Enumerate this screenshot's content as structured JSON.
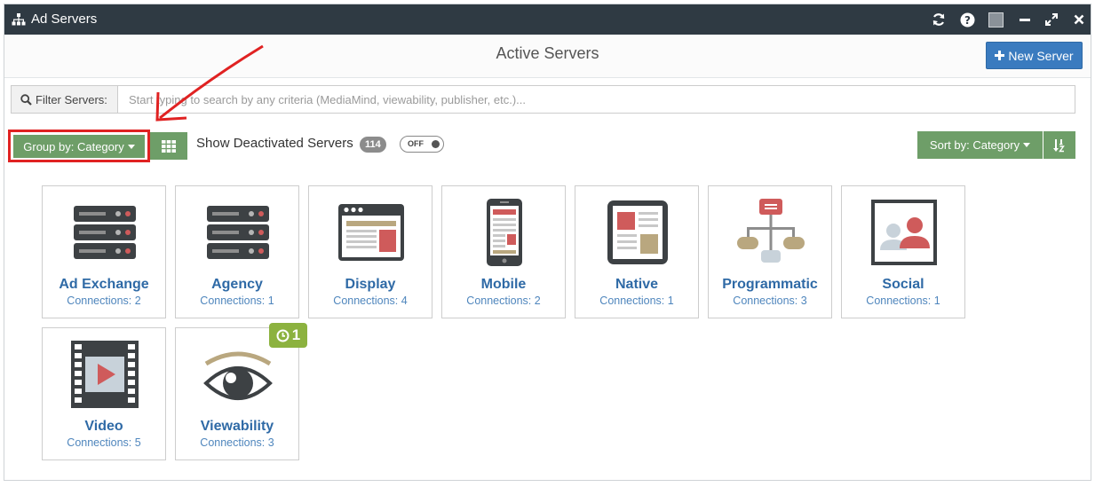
{
  "window": {
    "title": "Ad Servers",
    "controls": [
      "refresh-icon",
      "help-icon",
      "square-icon",
      "minimize-icon",
      "maximize-icon",
      "close-icon"
    ]
  },
  "header": {
    "title": "Active Servers",
    "new_button_label": "New Server"
  },
  "filter": {
    "label": "Filter Servers:",
    "placeholder": "Start typing to search by any criteria (MediaMind, viewability, publisher, etc.)..."
  },
  "toolbar": {
    "group_label": "Group by: Category",
    "show_deactivated_label": "Show Deactivated Servers",
    "deactivated_count": "114",
    "toggle_label": "OFF",
    "sort_label": "Sort by: Category"
  },
  "tiles": [
    {
      "name": "Ad Exchange",
      "connections": "Connections: 2",
      "icon": "server-rack-icon"
    },
    {
      "name": "Agency",
      "connections": "Connections: 1",
      "icon": "server-rack-icon"
    },
    {
      "name": "Display",
      "connections": "Connections: 4",
      "icon": "browser-window-icon"
    },
    {
      "name": "Mobile",
      "connections": "Connections: 2",
      "icon": "mobile-phone-icon"
    },
    {
      "name": "Native",
      "connections": "Connections: 1",
      "icon": "tablet-article-icon"
    },
    {
      "name": "Programmatic",
      "connections": "Connections: 3",
      "icon": "hierarchy-icon"
    },
    {
      "name": "Social",
      "connections": "Connections: 1",
      "icon": "users-icon"
    },
    {
      "name": "Video",
      "connections": "Connections: 5",
      "icon": "film-strip-icon"
    },
    {
      "name": "Viewability",
      "connections": "Connections: 3",
      "icon": "eye-icon",
      "badge": "1"
    }
  ],
  "colors": {
    "titlebar": "#2f3a43",
    "primary_button": "#3a7bbf",
    "green_button": "#6e9e68",
    "tile_title": "#2f6aa6",
    "badge_green": "#8cb23f",
    "annotation_red": "#e02222"
  }
}
